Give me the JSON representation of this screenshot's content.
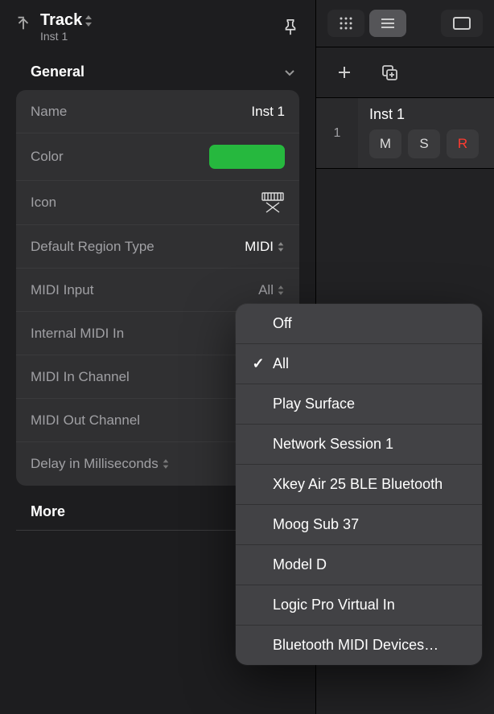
{
  "header": {
    "title": "Track",
    "subtitle": "Inst 1"
  },
  "sections": {
    "general_label": "General",
    "more_label": "More"
  },
  "settings": {
    "name_label": "Name",
    "name_value": "Inst 1",
    "color_label": "Color",
    "color_value": "#26b83e",
    "icon_label": "Icon",
    "region_label": "Default Region Type",
    "region_value": "MIDI",
    "midi_input_label": "MIDI Input",
    "midi_input_value": "All",
    "internal_label": "Internal MIDI In",
    "midi_in_ch_label": "MIDI In Channel",
    "midi_out_ch_label": "MIDI Out Channel",
    "delay_label": "Delay in Milliseconds"
  },
  "right": {
    "track_index": "1",
    "track_name": "Inst 1",
    "mute": "M",
    "solo": "S",
    "rec": "R"
  },
  "popup": {
    "selected_index": 1,
    "items": [
      "Off",
      "All",
      "Play Surface",
      "Network Session 1",
      "Xkey Air 25 BLE Bluetooth",
      "Moog Sub 37",
      "Model D",
      "Logic Pro Virtual In",
      "Bluetooth MIDI Devices…"
    ]
  }
}
